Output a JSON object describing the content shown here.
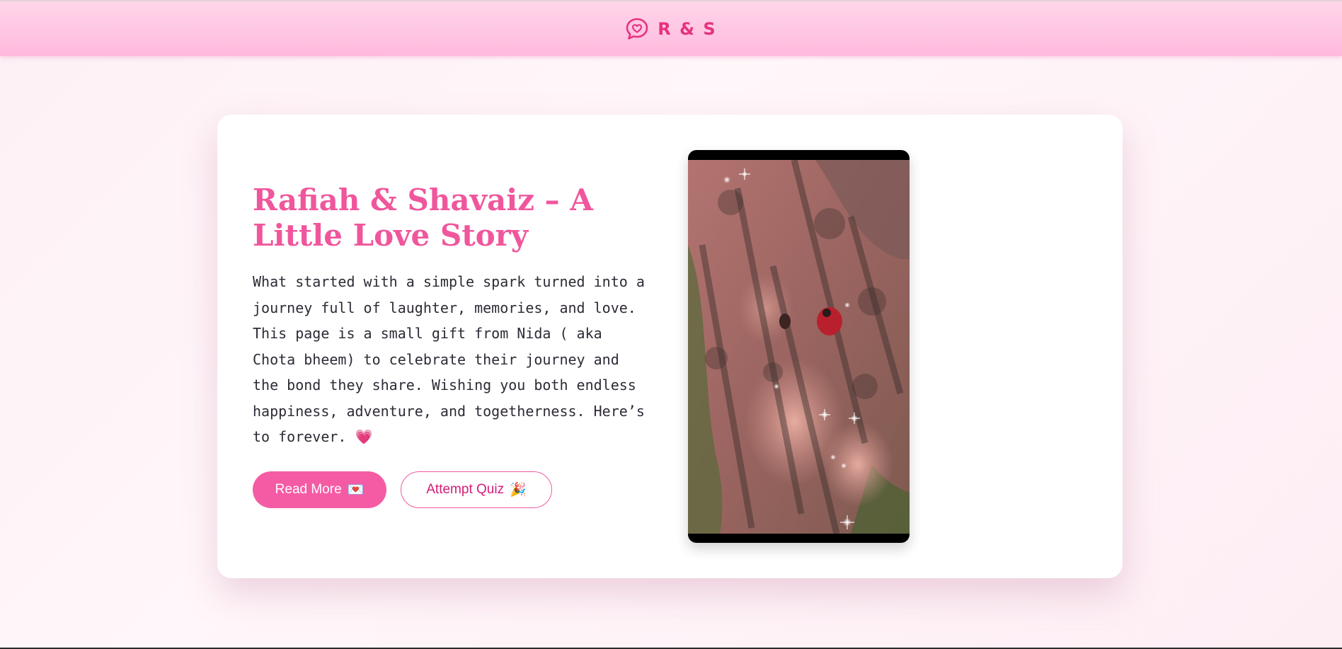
{
  "navbar": {
    "brand_icon": "heart-chat-bubble-icon",
    "brand_text": "R & S"
  },
  "hero": {
    "title": "Rafiah & Shavaiz – A Little Love Story",
    "description": "What started with a simple spark turned into a journey full of laughter, memories, and love. This page is a small gift from Nida ( aka Chota bheem) to celebrate their journey and the bond they share. Wishing you both endless happiness, adventure, and togetherness. Here’s to forever. 💗",
    "read_more_label": "Read More",
    "read_more_emoji": "💌",
    "quiz_label": "Attempt Quiz",
    "quiz_emoji": "🎉"
  },
  "colors": {
    "accent": "#f0569c",
    "button_primary": "#f55ba5",
    "navbar_top": "#ffd6ea",
    "navbar_bottom": "#ffb9dc"
  }
}
